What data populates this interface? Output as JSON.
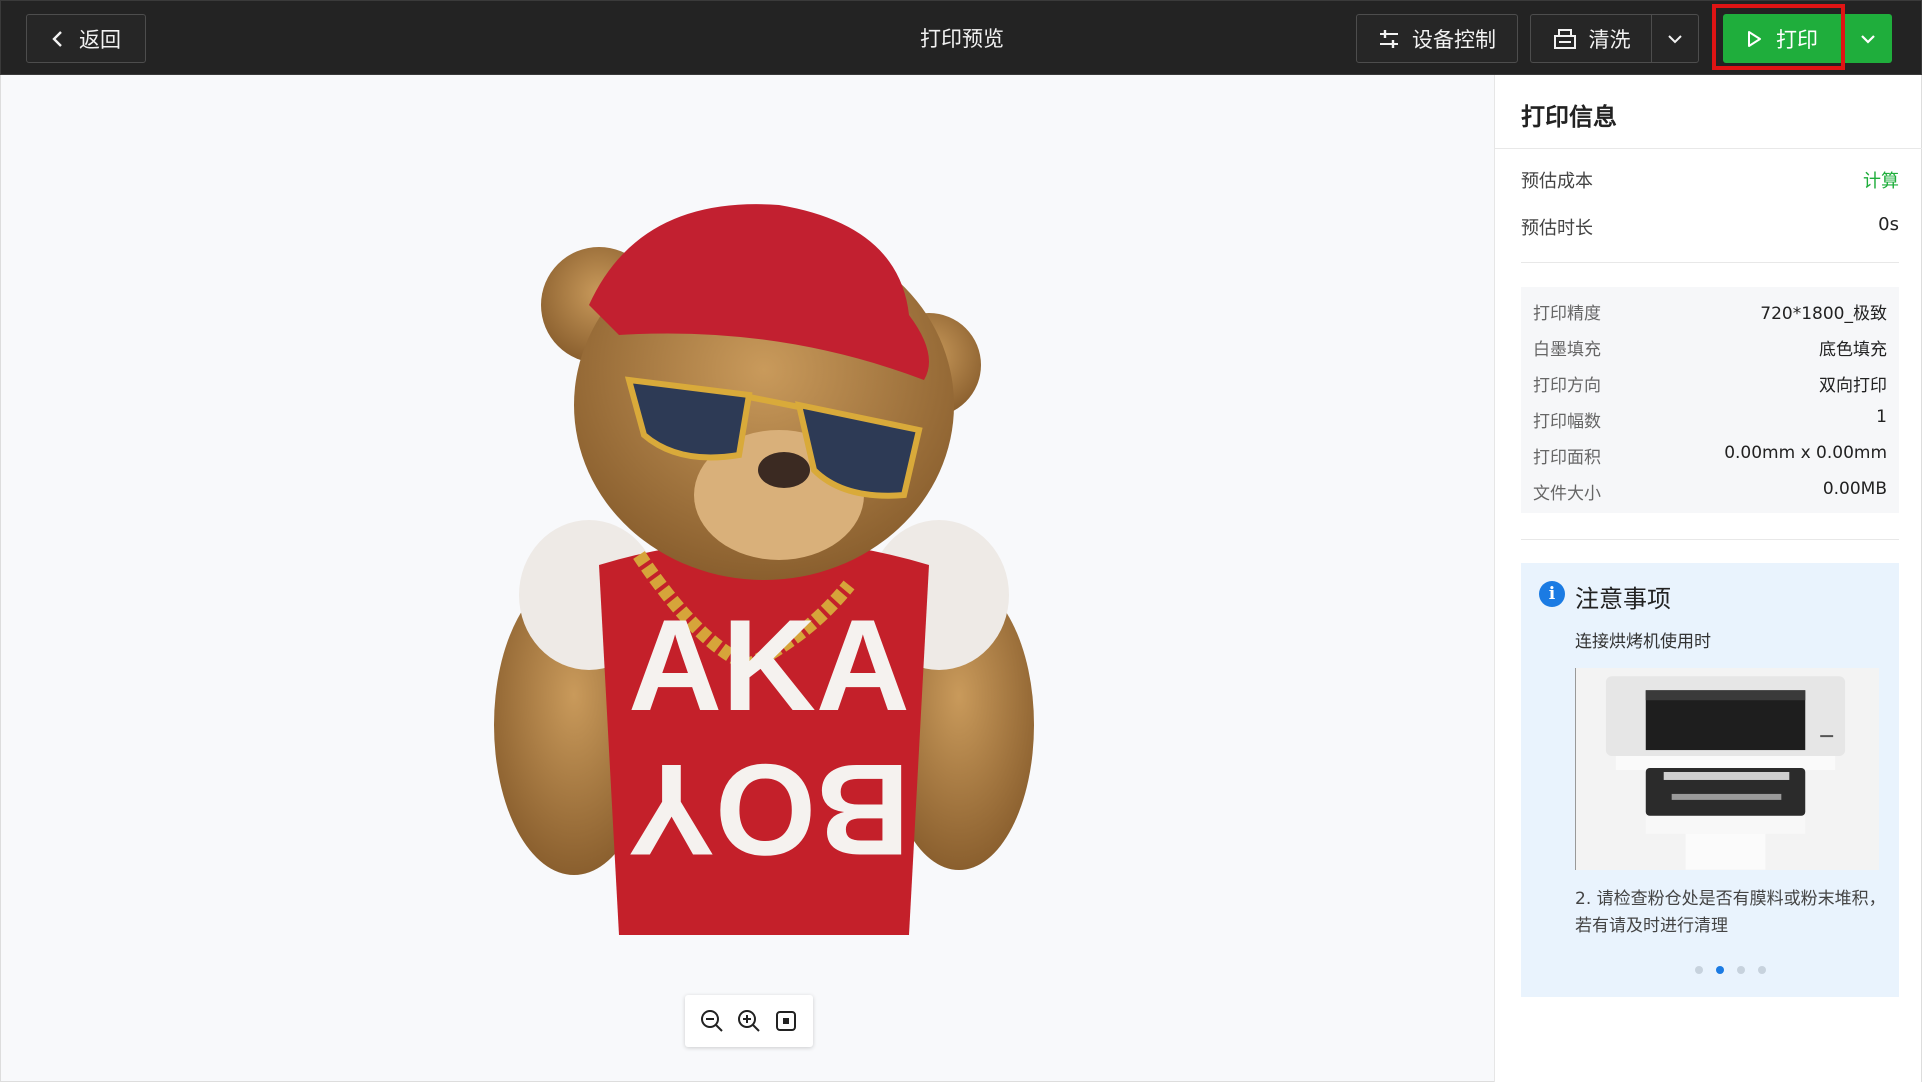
{
  "header": {
    "back_label": "返回",
    "title": "打印预览",
    "device_control_label": "设备控制",
    "clean_label": "清洗",
    "print_label": "打印"
  },
  "artwork": {
    "shirt_text_top": "AKA",
    "shirt_text_bottom": "BOY"
  },
  "panel": {
    "title": "打印信息",
    "cost_label": "预估成本",
    "cost_action": "计算",
    "duration_label": "预估时长",
    "duration_value": "0s",
    "info": [
      {
        "label": "打印精度",
        "value": "720*1800_极致"
      },
      {
        "label": "白墨填充",
        "value": "底色填充"
      },
      {
        "label": "打印方向",
        "value": "双向打印"
      },
      {
        "label": "打印幅数",
        "value": "1"
      },
      {
        "label": "打印面积",
        "value": "0.00mm x 0.00mm"
      },
      {
        "label": "文件大小",
        "value": "0.00MB"
      }
    ],
    "notice": {
      "title": "注意事项",
      "subtitle": "连接烘烤机使用时",
      "text": "2. 请检查粉仓处是否有膜料或粉末堆积，若有请及时进行清理",
      "active_slide": 2,
      "slide_count": 4
    }
  },
  "colors": {
    "print_green": "#1fae3c",
    "highlight_red": "#e01414",
    "notice_blue": "#1b7be3"
  }
}
